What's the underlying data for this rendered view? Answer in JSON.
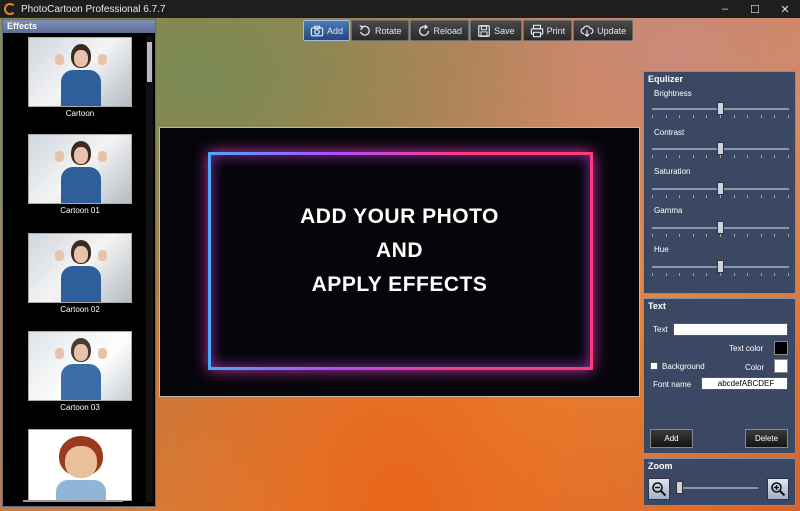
{
  "window": {
    "title": "PhotoCartoon Professional 6.7.7",
    "controls": [
      "–",
      "☐",
      "✕"
    ]
  },
  "effects": {
    "title": "Effects",
    "items": [
      {
        "label": "Cartoon"
      },
      {
        "label": "Cartoon 01"
      },
      {
        "label": "Cartoon 02"
      },
      {
        "label": "Cartoon 03"
      },
      {
        "label": ""
      }
    ]
  },
  "toolbar": {
    "buttons": [
      {
        "label": "Add",
        "icon": "camera-icon",
        "active": true
      },
      {
        "label": "Rotate",
        "icon": "rotate-icon"
      },
      {
        "label": "Reload",
        "icon": "reload-icon"
      },
      {
        "label": "Save",
        "icon": "floppy-icon"
      },
      {
        "label": "Print",
        "icon": "printer-icon"
      },
      {
        "label": "Update",
        "icon": "cloud-download-icon"
      }
    ]
  },
  "preview": {
    "lines": [
      "ADD YOUR PHOTO",
      "AND",
      "APPLY EFFECTS"
    ]
  },
  "equalizer": {
    "title": "Equlizer",
    "sliders": [
      {
        "label": "Brightness",
        "value": 0.5
      },
      {
        "label": "Contrast",
        "value": 0.5
      },
      {
        "label": "Saturation",
        "value": 0.5
      },
      {
        "label": "Gamma",
        "value": 0.5
      },
      {
        "label": "Hue",
        "value": 0.5
      }
    ]
  },
  "text_panel": {
    "title": "Text",
    "text_label": "Text",
    "text_value": "",
    "text_color_label": "Text color",
    "text_color": "#000000",
    "background_label": "Background",
    "background_checked": false,
    "color_label": "Color",
    "bg_color": "#ffffff",
    "font_name_label": "Font name",
    "font_name_value": "abcdefABCDEF",
    "add_label": "Add",
    "delete_label": "Delete"
  },
  "zoom": {
    "title": "Zoom",
    "value": 0.0
  }
}
